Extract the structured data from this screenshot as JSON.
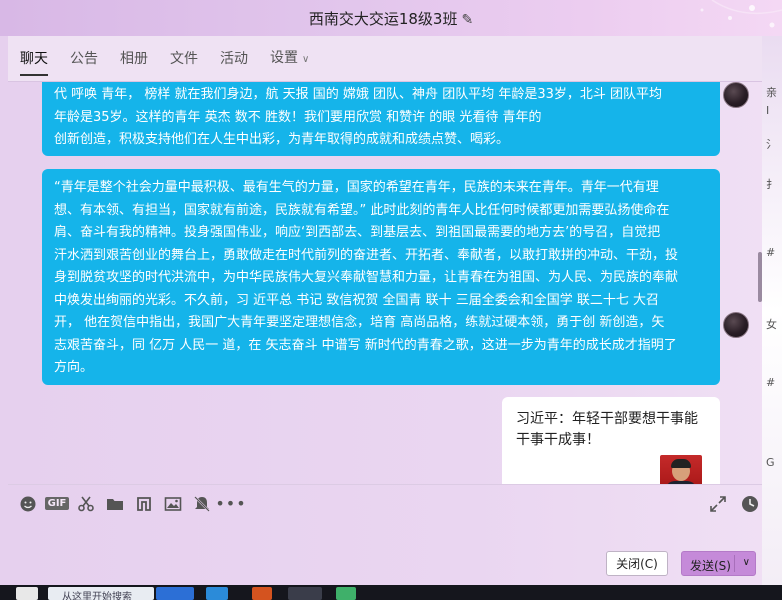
{
  "window": {
    "title": "西南交大交运18级3班"
  },
  "tabs": [
    {
      "label": "聊天",
      "active": true
    },
    {
      "label": "公告",
      "active": false
    },
    {
      "label": "相册",
      "active": false
    },
    {
      "label": "文件",
      "active": false
    },
    {
      "label": "活动",
      "active": false
    },
    {
      "label": "设置",
      "active": false,
      "dropdown": true
    }
  ],
  "messages": [
    {
      "type": "text",
      "lines": [
        "代  呼唤 青年，   榜样 就在我们身边，航 天报 国的 嫦娥 团队、神舟 团队平均  年龄是33岁，北斗 团队平均",
        "年龄是35岁。这样的青年  英杰 数不 胜数！我们要用欣赏 和赞许 的眼 光看待  青年的",
        "创新创造，积极支持他们在人生中出彩，为青年取得的成就和成绩点赞、喝彩。"
      ]
    },
    {
      "type": "text",
      "lines": [
        "“青年是整个社会力量中最积极、最有生气的力量，国家的希望在青年，民族的未来在青年。青年一代有理",
        "想、有本领、有担当，国家就有前途，民族就有希望。”  此时此刻的青年人比任何时候都更加需要弘扬使命在",
        "肩、奋斗有我的精神。投身强国伟业，响应‘到西部去、到基层去、到祖国最需要的地方去’的号召，自觉把",
        "汗水洒到艰苦创业的舞台上，勇敢做走在时代前列的奋进者、开拓者、奉献者，以敢打敢拼的冲动、干劲，投",
        "身到脱贫攻坚的时代洪流中，为中华民族伟大复兴奉献智慧和力量，让青春在为祖国、为人民、为民族的奉献",
        "中焕发出绚丽的光彩。不久前，习  近平总  书记 致信祝贺 全国青  联十 三届全委会和全国学  联二十七 大召",
        "开，  他在贺信中指出，我国广大青年要坚定理想信念，培育 高尚品格，练就过硬本领，勇于创  新创造，矢",
        "志艰苦奋斗，同 亿万 人民一  道，在 矢志奋斗 中谱写 新时代的青春之歌，这进一步为青年的成长成才指明了",
        "方向。"
      ]
    },
    {
      "type": "card",
      "title_lines": [
        "习近平：年轻干部要想干事能",
        "干事干成事！"
      ]
    }
  ],
  "toolbar": {
    "icons": [
      "emoji-icon",
      "gif-icon",
      "scissors-icon",
      "folder-icon",
      "music-icon",
      "image-icon",
      "mute-bell-icon",
      "more-icon"
    ],
    "gif_label": "GIF"
  },
  "buttons": {
    "close_label": "关闭(C)",
    "send_label": "发送(S)"
  },
  "taskbar": {
    "search_text": "从这里开始搜索"
  },
  "right_strip_chars": [
    "亲",
    "I",
    "氵",
    "扌",
    "#",
    "女",
    "#",
    "G"
  ]
}
